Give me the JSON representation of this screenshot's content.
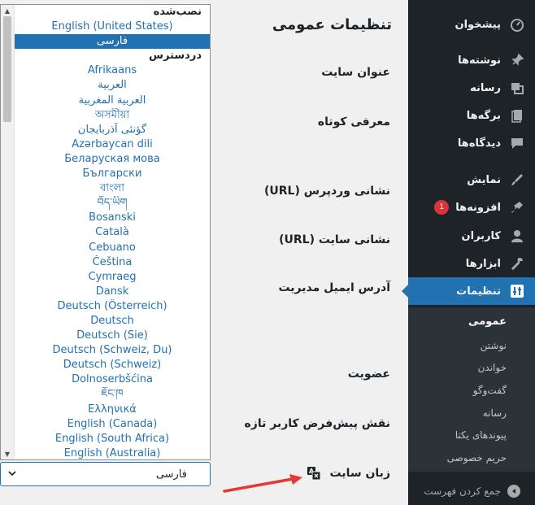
{
  "sidebar": {
    "items": [
      {
        "label": "پیشخوان",
        "icon": "dashboard-icon"
      },
      {
        "label": "نوشته‌ها",
        "icon": "pin-icon"
      },
      {
        "label": "رسانه",
        "icon": "media-icon"
      },
      {
        "label": "برگه‌ها",
        "icon": "pages-icon"
      },
      {
        "label": "دیدگاه‌ها",
        "icon": "comments-icon"
      },
      {
        "label": "نمایش",
        "icon": "appearance-icon"
      },
      {
        "label": "افزونه‌ها",
        "icon": "plugins-icon",
        "badge": "1"
      },
      {
        "label": "کاربران",
        "icon": "users-icon"
      },
      {
        "label": "ابزارها",
        "icon": "tools-icon"
      },
      {
        "label": "تنظیمات",
        "icon": "settings-icon",
        "active": true
      }
    ],
    "submenu": [
      "عمومی",
      "نوشتن",
      "خواندن",
      "گفت‌وگو",
      "رسانه",
      "پیوندهای یکتا",
      "حریم خصوصی"
    ],
    "collapse_label": "جمع کردن فهرست"
  },
  "content": {
    "page_title": "تنظیمات عمومی",
    "rows": {
      "site_title": "عنوان سایت",
      "tagline": "معرفی کوتاه",
      "wp_url": "نشانی وردپرس (URL)",
      "site_url": "نشانی سایت (URL)",
      "admin_email": "آدرس ایمیل مدیریت",
      "membership": "عضویت",
      "default_role": "نقش پیش‌فرض کاربر تازه",
      "site_language": "زبان سایت"
    }
  },
  "language_dropdown": {
    "installed_group": "نصب‌شده",
    "installed": [
      "English (United States)",
      "فارسی"
    ],
    "selected": "فارسی",
    "available_group": "دردسترس",
    "available": [
      "Afrikaans",
      "العربية",
      "العربية المغربية",
      "অসমীয়া",
      "گؤنئی آذربایجان",
      "Azərbaycan dili",
      "Беларуская мова",
      "Български",
      "বাংলা",
      "བོད་ཡིག",
      "Bosanski",
      "Català",
      "Cebuano",
      "Čeština",
      "Cymraeg",
      "Dansk",
      "Deutsch (Österreich)",
      "Deutsch",
      "Deutsch (Sie)",
      "Deutsch (Schweiz, Du)",
      "Deutsch (Schweiz)",
      "Dolnoserbšćina",
      "ཇོང་ཁ",
      "Ελληνικά",
      "English (Canada)",
      "English (South Africa)",
      "English (Australia)"
    ],
    "current_value": "فارسی"
  },
  "colors": {
    "sidebar_bg": "#1d2327",
    "submenu_bg": "#2c3338",
    "accent": "#2271b1",
    "badge": "#d63638",
    "annotation_arrow": "#e53935"
  }
}
